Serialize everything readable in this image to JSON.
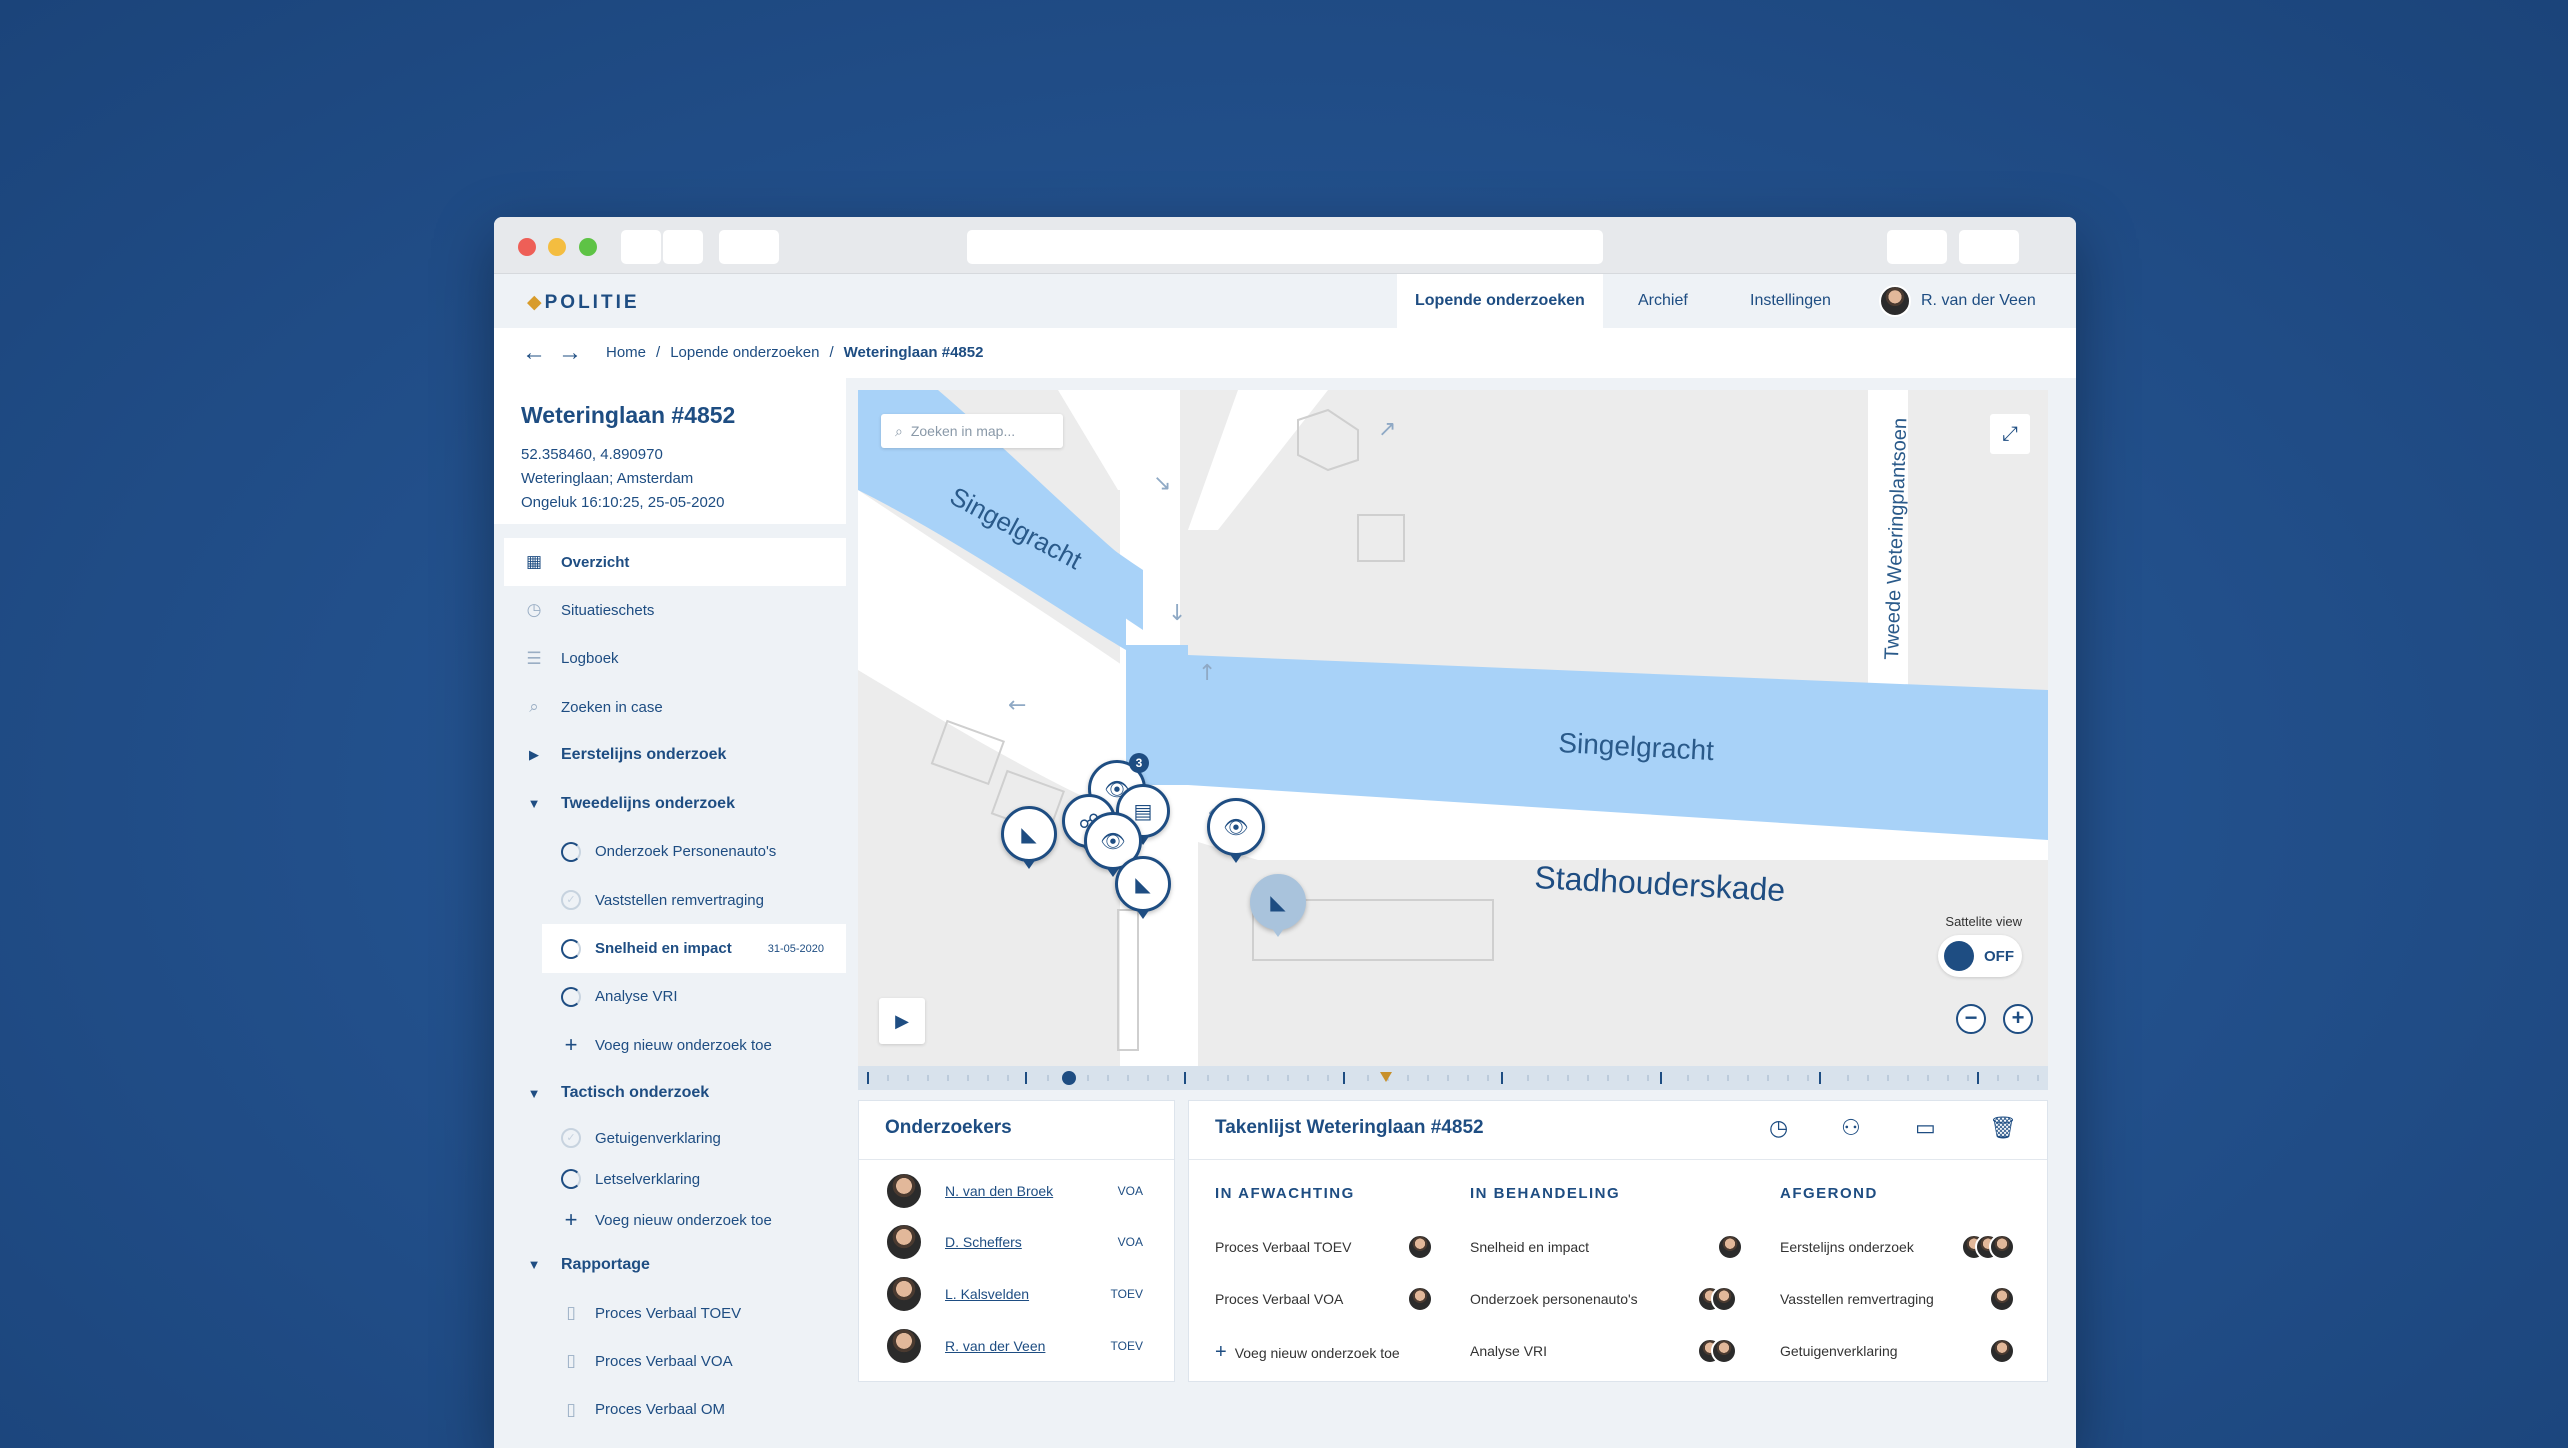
{
  "nav": {
    "logo": "POLITIE",
    "tabs": [
      "Lopende onderzoeken",
      "Archief",
      "Instellingen"
    ],
    "user": "R. van der Veen"
  },
  "breadcrumb": [
    "Home",
    "Lopende onderzoeken",
    "Weteringlaan #4852"
  ],
  "case": {
    "title": "Weteringlaan #4852",
    "coords": "52.358460, 4.890970",
    "address": "Weteringlaan; Amsterdam",
    "incident": "Ongeluk 16:10:25, 25-05-2020"
  },
  "sidebar": {
    "overzicht": "Overzicht",
    "situatieschets": "Situatieschets",
    "logboek": "Logboek",
    "zoeken": "Zoeken in case",
    "eerstelijns": "Eerstelijns onderzoek",
    "tweedelijns": "Tweedelijns onderzoek",
    "tw_items": [
      "Onderzoek Personenauto's",
      "Vaststellen remvertraging",
      "Snelheid en impact",
      "Analyse VRI"
    ],
    "tw_active_date": "31-05-2020",
    "add_new": "Voeg nieuw onderzoek toe",
    "tactisch": "Tactisch onderzoek",
    "ta_items": [
      "Getuigenverklaring",
      "Letselverklaring"
    ],
    "rapportage": "Rapportage",
    "ra_items": [
      "Proces Verbaal TOEV",
      "Proces Verbaal VOA",
      "Proces Verbaal OM"
    ]
  },
  "map": {
    "search_placeholder": "Zoeken in map...",
    "streets": [
      "Singelgracht",
      "Singelgracht",
      "Stadhouderskade",
      "Tweede Weteringplantsoen"
    ],
    "satellite_label": "Sattelite view",
    "satellite_state": "OFF",
    "cluster_badge": "3"
  },
  "researchers": {
    "title": "Onderzoekers",
    "list": [
      {
        "name": "N. van den Broek",
        "role": "VOA"
      },
      {
        "name": "D. Scheffers",
        "role": "VOA"
      },
      {
        "name": "L. Kalsvelden",
        "role": "TOEV"
      },
      {
        "name": "R. van der Veen",
        "role": "TOEV"
      }
    ]
  },
  "tasks": {
    "title": "Takenlijst Weteringlaan #4852",
    "columns": [
      "IN AFWACHTING",
      "IN BEHANDELING",
      "AFGEROND"
    ],
    "waiting": [
      "Proces Verbaal TOEV",
      "Proces Verbaal VOA"
    ],
    "add_new": "Voeg nieuw onderzoek toe",
    "in_progress": [
      "Snelheid en impact",
      "Onderzoek personenauto's",
      "Analyse VRI"
    ],
    "done": [
      "Eerstelijns onderzoek",
      "Vasstellen remvertraging",
      "Getuigenverklaring"
    ]
  },
  "colors": {
    "primary": "#1e4d82",
    "water": "#a8d2f8",
    "background": "#23518d"
  }
}
